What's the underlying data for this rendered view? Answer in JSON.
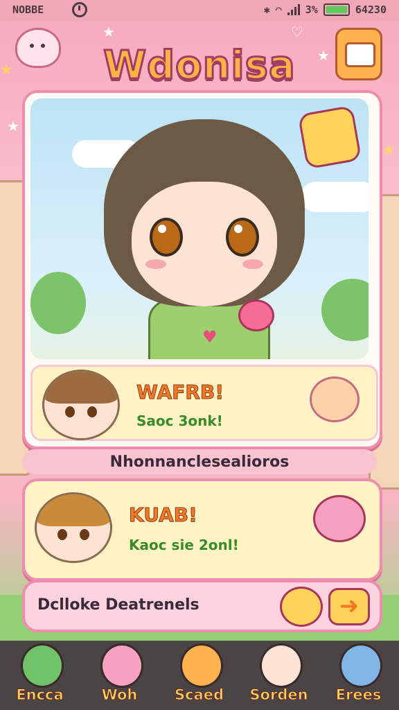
{
  "status_bar": {
    "carrier": "NOBBE",
    "battery_percent": "3%",
    "time": "64230"
  },
  "header": {
    "title": "Wdonisa"
  },
  "cards": [
    {
      "name": "WAFRB!",
      "message": "Saoc 3onk!"
    },
    {
      "name": "KUAB!",
      "message": "Kaoc sie 2onl!"
    }
  ],
  "section_label": "Nhonnanclesealioros",
  "action_bar": {
    "label": "Dclloke Deatrenels",
    "arrow": "➜"
  },
  "nav": [
    {
      "label": "Encca",
      "icon": "parrot-icon",
      "color": "#6fc46b"
    },
    {
      "label": "Woh",
      "icon": "pig-icon",
      "color": "#f7a1c0"
    },
    {
      "label": "Scaed",
      "icon": "basket-icon",
      "color": "#ffb24d"
    },
    {
      "label": "Sorden",
      "icon": "girl-icon",
      "color": "#fde3d3"
    },
    {
      "label": "Erees",
      "icon": "dino-icon",
      "color": "#7fb6e5"
    }
  ],
  "colors": {
    "accent": "#f08cae",
    "title_fill": "#ffb347",
    "name_text": "#f07a28",
    "message_text": "#3b8a2a"
  }
}
